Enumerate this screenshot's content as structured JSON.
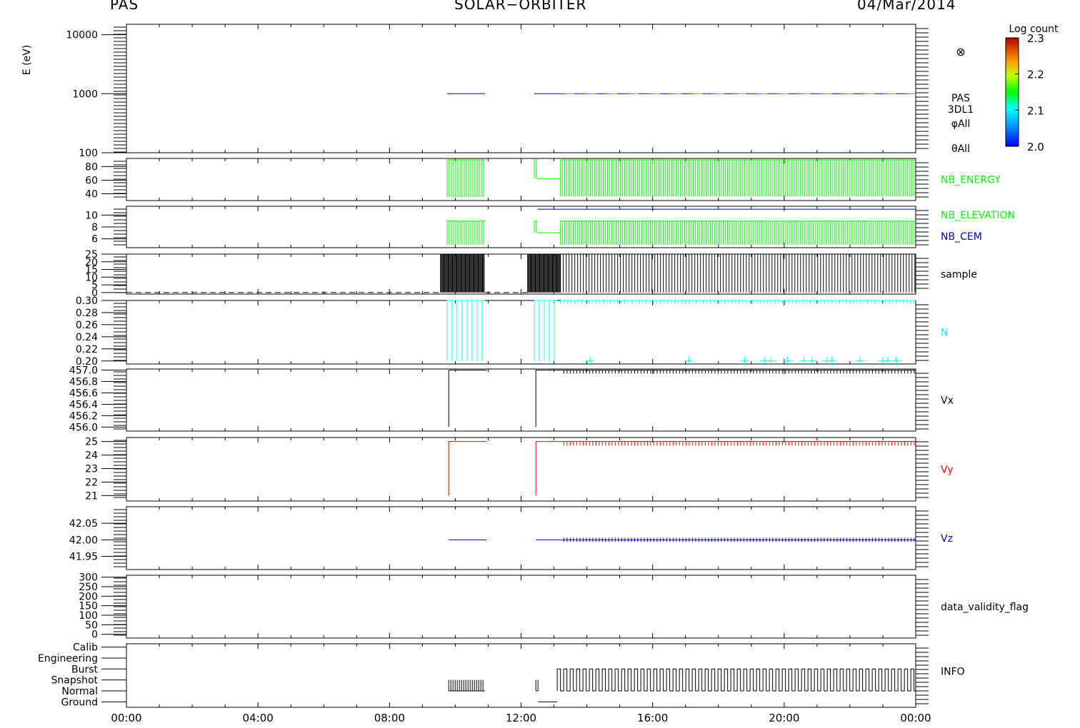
{
  "header": {
    "left": "PAS",
    "center": "SOLAR−ORBITER",
    "right": "04/Mar/2014"
  },
  "colors": {
    "green": "#00ff00",
    "blue": "#0000c8",
    "cyan": "#00ffff",
    "red": "#ff0000",
    "black": "#000000"
  },
  "colorbar": {
    "title": "Log count",
    "ticks": [
      "2.3",
      "2.2",
      "2.1",
      "2.0"
    ],
    "range": [
      2.0,
      2.3
    ]
  },
  "chart_data": {
    "type": "line",
    "x_axis": {
      "range_hours": [
        0,
        24
      ],
      "tick_labels": [
        "00:00",
        "04:00",
        "08:00",
        "12:00",
        "16:00",
        "20:00",
        "00:00"
      ]
    },
    "panels": [
      {
        "id": "spectrogram",
        "type": "heatmap",
        "ylabel": "E (eV)",
        "y_scale": "log",
        "ylim": [
          100,
          15000
        ],
        "y_tick_labels": [
          "10000",
          "1000",
          "100"
        ],
        "right_labels": [
          "PAS",
          "3DL1",
          "φAll",
          "θAll"
        ],
        "right_symbol": "⊗",
        "energy_level_eV": 1000,
        "active_intervals_hours": [
          [
            9.75,
            10.9
          ],
          [
            12.4,
            24.0
          ]
        ]
      },
      {
        "id": "nb_energy",
        "label": "NB_ENERGY",
        "color": "green",
        "ylim": [
          30,
          92
        ],
        "y_tick_labels": [
          "80",
          "60",
          "40"
        ],
        "segments": [
          {
            "start": 9.75,
            "end": 10.9,
            "low": 35,
            "high": 90
          },
          {
            "start": 12.4,
            "end": 12.5,
            "low": 62,
            "high": 90
          },
          {
            "start": 12.5,
            "end": 13.2,
            "low": 62,
            "high": 62
          },
          {
            "start": 13.2,
            "end": 24.0,
            "low": 36,
            "high": 90
          }
        ]
      },
      {
        "id": "nb_elevation",
        "labels": [
          "NB_ELEVATION",
          "NB_CEM"
        ],
        "label_colors": [
          "green",
          "blue"
        ],
        "color": "green",
        "ylim": [
          4.5,
          11.5
        ],
        "y_tick_labels": [
          "10",
          "8",
          "6"
        ],
        "reference_value": 11,
        "segments": [
          {
            "start": 9.75,
            "end": 10.9,
            "low": 5,
            "high": 9
          },
          {
            "start": 12.4,
            "end": 12.5,
            "low": 7,
            "high": 9
          },
          {
            "start": 12.5,
            "end": 13.2,
            "low": 7,
            "high": 7
          },
          {
            "start": 13.2,
            "end": 24.0,
            "low": 5,
            "high": 9
          }
        ]
      },
      {
        "id": "sample",
        "label": "sample",
        "color": "black",
        "ylim": [
          -1,
          25
        ],
        "y_tick_labels": [
          "25",
          "20",
          "15",
          "10",
          "5",
          "0"
        ],
        "baseline_value": 0,
        "segments": [
          {
            "start": 9.55,
            "end": 10.9,
            "low": 0,
            "high": 25
          },
          {
            "start": 12.2,
            "end": 13.2,
            "low": 0,
            "high": 25
          },
          {
            "start": 13.2,
            "end": 24.0,
            "low": 0,
            "high": 25
          }
        ]
      },
      {
        "id": "n",
        "label": "N",
        "color": "cyan",
        "ylim": [
          0.195,
          0.3
        ],
        "y_tick_labels": [
          "0.30",
          "0.28",
          "0.26",
          "0.24",
          "0.22",
          "0.20"
        ],
        "segments": [
          {
            "start": 9.75,
            "end": 10.9,
            "low": 0.2,
            "high": 0.3
          },
          {
            "start": 12.4,
            "end": 13.1,
            "low": 0.2,
            "high": 0.3
          },
          {
            "start": 13.2,
            "end": 24.0,
            "low": 0.295,
            "high": 0.3
          }
        ],
        "markers_value": 0.2,
        "markers_hours": [
          14.1,
          17.1,
          18.8,
          19.4,
          19.6,
          20.1,
          20.6,
          20.85,
          21.3,
          21.45,
          22.3,
          23.0,
          23.15,
          23.4
        ]
      },
      {
        "id": "vx",
        "label": "Vx",
        "color": "black",
        "ylim": [
          455.93,
          457.02
        ],
        "y_tick_labels": [
          "457.0",
          "456.8",
          "456.6",
          "456.4",
          "456.2",
          "456.0"
        ],
        "step_from": 456.0,
        "level": 457.0,
        "segments": [
          {
            "start": 9.8,
            "end": 10.95
          },
          {
            "start": 12.45,
            "end": 24.0
          }
        ],
        "dense_from": 13.3,
        "dense_low": 456.94
      },
      {
        "id": "vy",
        "label": "Vy",
        "color": "red",
        "ylim": [
          20.6,
          25.3
        ],
        "y_tick_labels": [
          "25",
          "24",
          "23",
          "22",
          "21"
        ],
        "step_from": 21,
        "level": 25,
        "segments": [
          {
            "start": 9.8,
            "end": 10.95
          },
          {
            "start": 12.45,
            "end": 24.0
          }
        ],
        "dense_from": 13.3,
        "dense_low": 24.7
      },
      {
        "id": "vz",
        "label": "Vz",
        "color": "blue",
        "ylim": [
          41.91,
          42.1
        ],
        "y_tick_labels": [
          "42.05",
          "42.00",
          "41.95"
        ],
        "level": 42.0,
        "segments": [
          {
            "start": 9.8,
            "end": 10.95
          },
          {
            "start": 12.45,
            "end": 24.0
          }
        ],
        "dense_from": 13.3,
        "dense_spread": 0.006
      },
      {
        "id": "data_validity_flag",
        "label": "data_validity_flag",
        "color": "black",
        "ylim": [
          -20,
          310
        ],
        "y_tick_labels": [
          "300",
          "250",
          "200",
          "150",
          "100",
          "50",
          "0"
        ],
        "segments": []
      },
      {
        "id": "info",
        "label": "INFO",
        "color": "black",
        "y_categories": [
          "Ground",
          "Normal",
          "Snapshot",
          "Burst",
          "Engineering",
          "Calib"
        ],
        "ylim": [
          -0.5,
          5.3
        ],
        "segments": [
          {
            "start": 9.8,
            "end": 10.9,
            "low": 1,
            "high": 2
          },
          {
            "start": 12.45,
            "end": 12.52,
            "low": 1,
            "high": 2
          },
          {
            "start": 12.52,
            "end": 13.1,
            "low": 0,
            "high": 0
          },
          {
            "start": 13.1,
            "end": 24.0,
            "low": 1,
            "high": 3
          }
        ]
      }
    ]
  }
}
